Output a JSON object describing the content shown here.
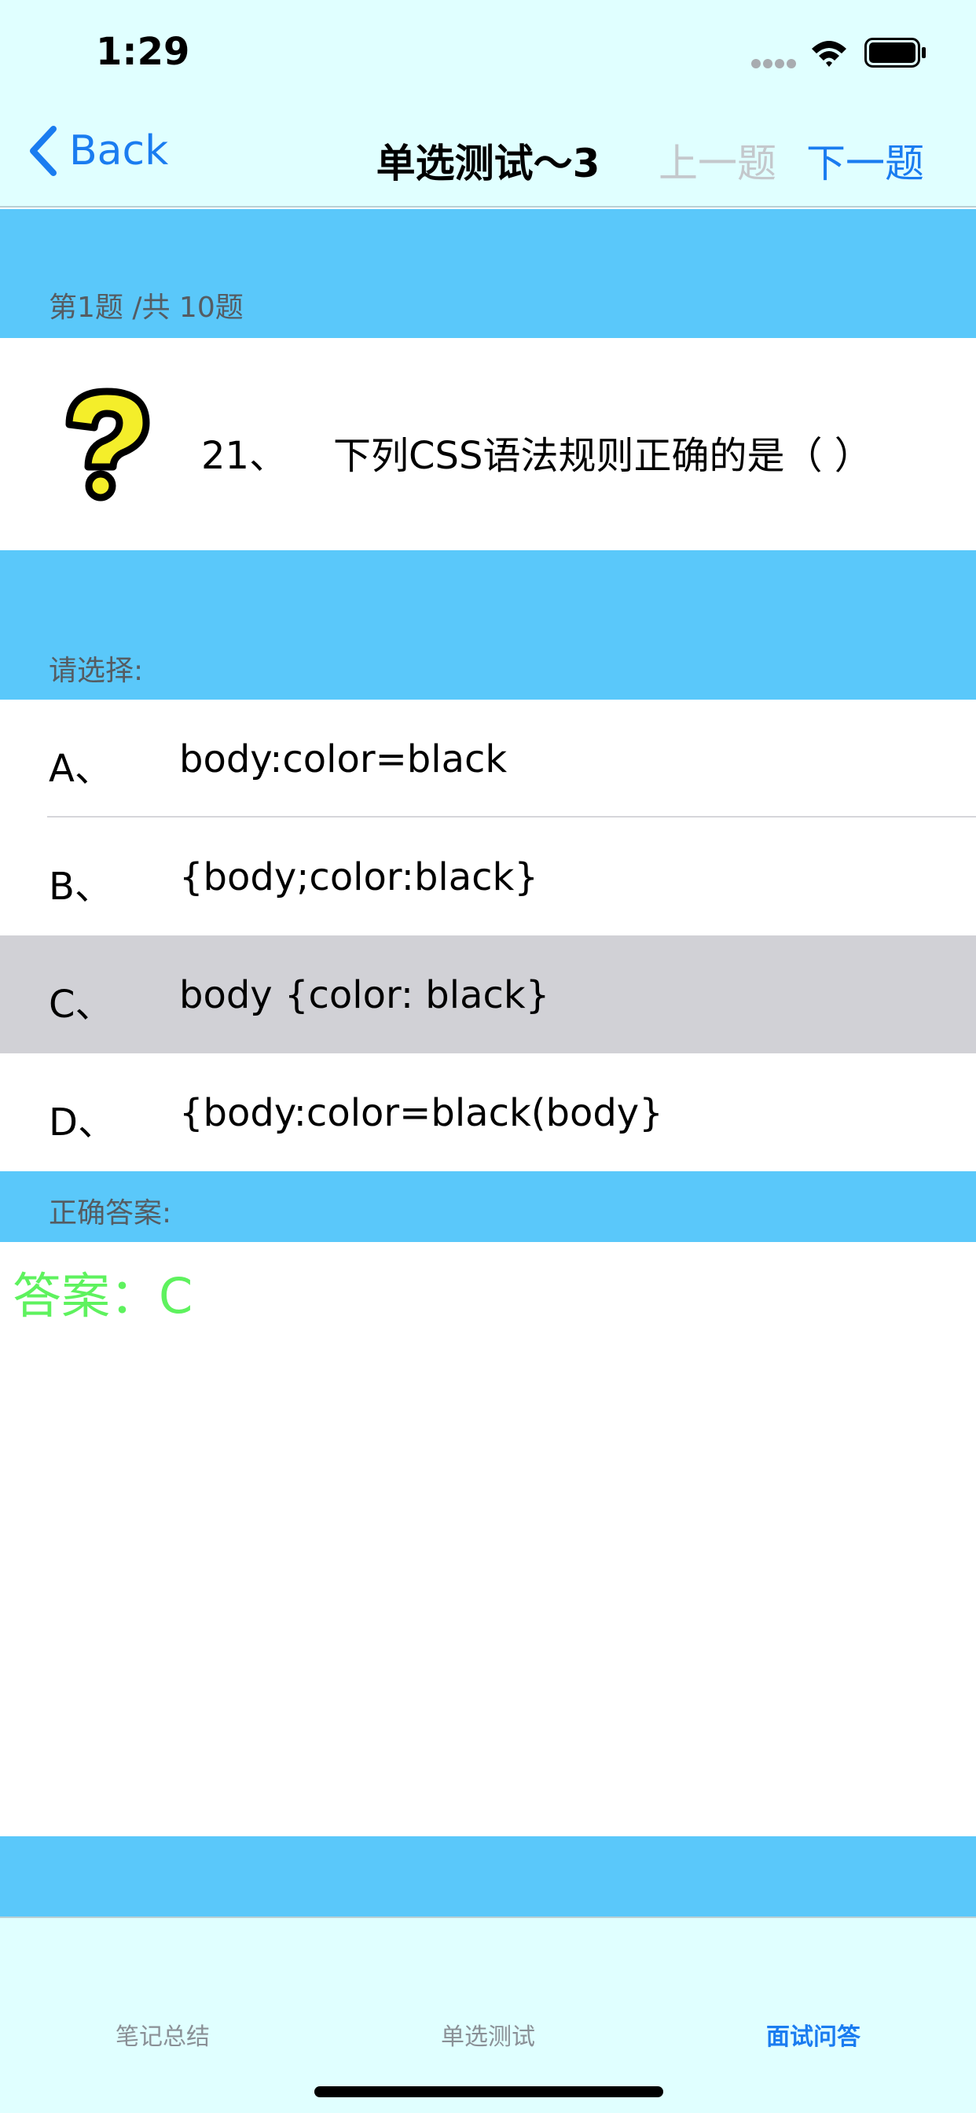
{
  "status_bar": {
    "time": "1:29"
  },
  "nav": {
    "back_label": "Back",
    "title": "单选测试～3",
    "prev_label": "上一题",
    "next_label": "下一题"
  },
  "progress": {
    "label": "第1题 /共 10题"
  },
  "question": {
    "number": "21、",
    "text": "下列CSS语法规则正确的是（ ）"
  },
  "choices_header": "请选择:",
  "options": [
    {
      "letter": "A、",
      "text": "body:color=black"
    },
    {
      "letter": "B、",
      "text": "{body;color:black}"
    },
    {
      "letter": "C、",
      "text": "body {color: black}"
    },
    {
      "letter": "D、",
      "text": "{body:color=black(body}"
    }
  ],
  "selected_option": "C",
  "answer_header": "正确答案:",
  "answer_text": "答案：C",
  "tabs": [
    {
      "label": "笔记总结"
    },
    {
      "label": "单选测试"
    },
    {
      "label": "面试问答"
    }
  ],
  "active_tab": "面试问答",
  "colors": {
    "accent": "#1a7cf0",
    "band": "#5ac8fa",
    "bar_background": "#e0ffff",
    "answer": "#5ef25e",
    "selected_row": "#d1d1d6"
  },
  "icons": {
    "back": "chevron-left-icon",
    "question": "question-mark-icon",
    "signal": "signal-icon",
    "wifi": "wifi-icon",
    "battery": "battery-icon"
  }
}
